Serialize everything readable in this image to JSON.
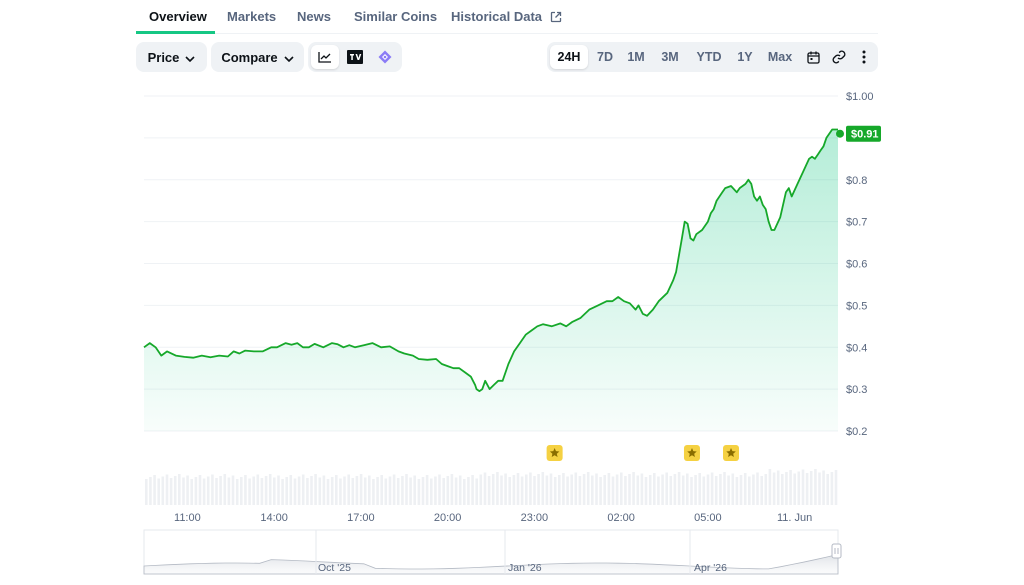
{
  "tabs": [
    {
      "label": "Overview",
      "active": true
    },
    {
      "label": "Markets"
    },
    {
      "label": "News"
    },
    {
      "label": "Similar Coins"
    },
    {
      "label": "Historical Data",
      "icon": "external-link-icon"
    }
  ],
  "toolbar": {
    "price_label": "Price",
    "compare_label": "Compare",
    "chart_type_icons": [
      "line-chart-icon",
      "tradingview-icon",
      "diamond-icon"
    ],
    "ranges": [
      "24H",
      "7D",
      "1M",
      "3M",
      "YTD",
      "1Y",
      "Max"
    ],
    "selected_range": "24H",
    "extra_icons": [
      "calendar-icon",
      "link-icon",
      "more-vertical-icon"
    ]
  },
  "colors": {
    "accent": "#16c784",
    "line": "#16a82a",
    "price_tag": "#16a82a",
    "marker": "#f5d142",
    "text_muted": "#58667e",
    "button_bg": "#eff2f5"
  },
  "chart_data": {
    "type": "line",
    "x_unit": "hours",
    "y_ticks": [
      {
        "label": "$1.00",
        "value": 1.0
      },
      {
        "label": "$0.8",
        "value": 0.8
      },
      {
        "label": "$0.7",
        "value": 0.7
      },
      {
        "label": "$0.6",
        "value": 0.6
      },
      {
        "label": "$0.5",
        "value": 0.5
      },
      {
        "label": "$0.4",
        "value": 0.4
      },
      {
        "label": "$0.3",
        "value": 0.3
      },
      {
        "label": "$0.2",
        "value": 0.2
      }
    ],
    "ylim": [
      0.2,
      1.0
    ],
    "x_ticks": [
      {
        "label": "11:00",
        "value": 1.0
      },
      {
        "label": "14:00",
        "value": 4.0
      },
      {
        "label": "17:00",
        "value": 7.0
      },
      {
        "label": "20:00",
        "value": 10.0
      },
      {
        "label": "23:00",
        "value": 13.0
      },
      {
        "label": "02:00",
        "value": 16.0
      },
      {
        "label": "05:00",
        "value": 19.0
      },
      {
        "label": "11. Jun",
        "value": 22.0
      }
    ],
    "xlim": [
      -0.5,
      23.5
    ],
    "current_price_label": "$0.91",
    "current_price": 0.91,
    "grid": true,
    "points": [
      [
        -0.5,
        0.4
      ],
      [
        -0.3,
        0.41
      ],
      [
        -0.1,
        0.4
      ],
      [
        0.1,
        0.38
      ],
      [
        0.3,
        0.39
      ],
      [
        0.6,
        0.38
      ],
      [
        0.9,
        0.377
      ],
      [
        1.2,
        0.375
      ],
      [
        1.5,
        0.38
      ],
      [
        1.8,
        0.376
      ],
      [
        2.1,
        0.38
      ],
      [
        2.4,
        0.378
      ],
      [
        2.6,
        0.39
      ],
      [
        2.8,
        0.385
      ],
      [
        3.0,
        0.392
      ],
      [
        3.3,
        0.39
      ],
      [
        3.6,
        0.39
      ],
      [
        3.9,
        0.4
      ],
      [
        4.1,
        0.4
      ],
      [
        4.4,
        0.41
      ],
      [
        4.6,
        0.406
      ],
      [
        4.8,
        0.41
      ],
      [
        5.0,
        0.4
      ],
      [
        5.2,
        0.4
      ],
      [
        5.4,
        0.408
      ],
      [
        5.7,
        0.4
      ],
      [
        6.0,
        0.41
      ],
      [
        6.2,
        0.407
      ],
      [
        6.4,
        0.4
      ],
      [
        6.6,
        0.405
      ],
      [
        6.8,
        0.4
      ],
      [
        7.1,
        0.405
      ],
      [
        7.4,
        0.41
      ],
      [
        7.7,
        0.4
      ],
      [
        8.0,
        0.402
      ],
      [
        8.3,
        0.39
      ],
      [
        8.5,
        0.385
      ],
      [
        8.8,
        0.38
      ],
      [
        9.0,
        0.372
      ],
      [
        9.3,
        0.37
      ],
      [
        9.6,
        0.372
      ],
      [
        9.8,
        0.36
      ],
      [
        10.0,
        0.355
      ],
      [
        10.2,
        0.35
      ],
      [
        10.4,
        0.35
      ],
      [
        10.6,
        0.34
      ],
      [
        10.8,
        0.33
      ],
      [
        10.95,
        0.31
      ],
      [
        11.0,
        0.3
      ],
      [
        11.1,
        0.295
      ],
      [
        11.2,
        0.3
      ],
      [
        11.3,
        0.32
      ],
      [
        11.45,
        0.3
      ],
      [
        11.6,
        0.31
      ],
      [
        11.75,
        0.32
      ],
      [
        11.9,
        0.32
      ],
      [
        12.1,
        0.36
      ],
      [
        12.3,
        0.39
      ],
      [
        12.5,
        0.41
      ],
      [
        12.7,
        0.43
      ],
      [
        12.9,
        0.44
      ],
      [
        13.1,
        0.45
      ],
      [
        13.3,
        0.455
      ],
      [
        13.6,
        0.45
      ],
      [
        13.9,
        0.457
      ],
      [
        14.1,
        0.45
      ],
      [
        14.3,
        0.46
      ],
      [
        14.6,
        0.47
      ],
      [
        14.9,
        0.49
      ],
      [
        15.2,
        0.5
      ],
      [
        15.5,
        0.51
      ],
      [
        15.7,
        0.51
      ],
      [
        15.9,
        0.52
      ],
      [
        16.1,
        0.51
      ],
      [
        16.3,
        0.505
      ],
      [
        16.5,
        0.49
      ],
      [
        16.6,
        0.5
      ],
      [
        16.75,
        0.48
      ],
      [
        16.9,
        0.475
      ],
      [
        17.1,
        0.49
      ],
      [
        17.3,
        0.51
      ],
      [
        17.6,
        0.53
      ],
      [
        17.8,
        0.56
      ],
      [
        17.9,
        0.58
      ],
      [
        18.0,
        0.62
      ],
      [
        18.1,
        0.66
      ],
      [
        18.2,
        0.7
      ],
      [
        18.3,
        0.695
      ],
      [
        18.4,
        0.66
      ],
      [
        18.5,
        0.655
      ],
      [
        18.6,
        0.67
      ],
      [
        18.8,
        0.68
      ],
      [
        19.0,
        0.7
      ],
      [
        19.1,
        0.72
      ],
      [
        19.2,
        0.73
      ],
      [
        19.3,
        0.75
      ],
      [
        19.5,
        0.77
      ],
      [
        19.6,
        0.78
      ],
      [
        19.8,
        0.785
      ],
      [
        20.0,
        0.77
      ],
      [
        20.1,
        0.78
      ],
      [
        20.3,
        0.79
      ],
      [
        20.4,
        0.8
      ],
      [
        20.5,
        0.79
      ],
      [
        20.6,
        0.76
      ],
      [
        20.7,
        0.75
      ],
      [
        20.8,
        0.76
      ],
      [
        20.9,
        0.74
      ],
      [
        21.0,
        0.73
      ],
      [
        21.1,
        0.7
      ],
      [
        21.2,
        0.68
      ],
      [
        21.3,
        0.68
      ],
      [
        21.5,
        0.71
      ],
      [
        21.7,
        0.77
      ],
      [
        21.8,
        0.78
      ],
      [
        21.9,
        0.76
      ],
      [
        22.1,
        0.79
      ],
      [
        22.3,
        0.82
      ],
      [
        22.5,
        0.85
      ],
      [
        22.6,
        0.855
      ],
      [
        22.7,
        0.85
      ],
      [
        22.8,
        0.86
      ],
      [
        22.9,
        0.87
      ],
      [
        23.0,
        0.88
      ],
      [
        23.1,
        0.9
      ],
      [
        23.3,
        0.92
      ],
      [
        23.5,
        0.92
      ]
    ],
    "event_markers": [
      {
        "icon": "star-icon",
        "x": 13.7
      },
      {
        "icon": "star-icon",
        "x": 18.45
      },
      {
        "icon": "star-icon",
        "x": 19.8
      }
    ],
    "navigator_labels": [
      "Oct '25",
      "Jan '26",
      "Apr '26"
    ]
  }
}
